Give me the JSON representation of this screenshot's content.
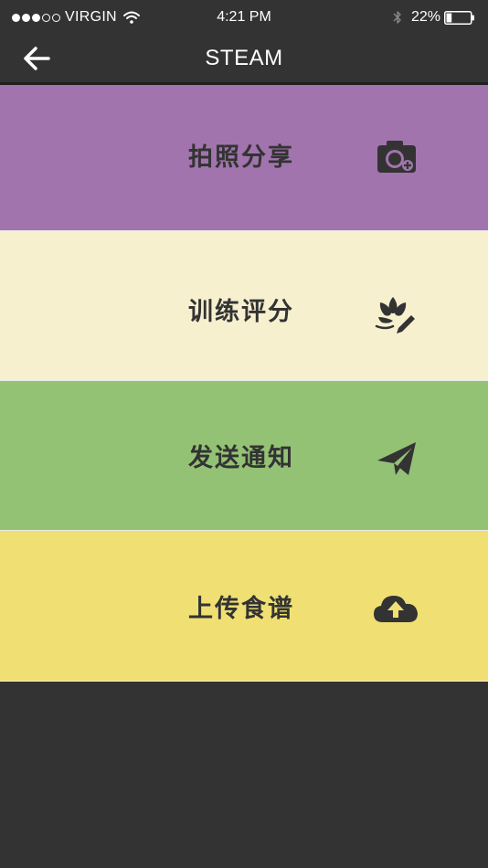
{
  "status_bar": {
    "carrier": "VIRGIN",
    "time": "4:21 PM",
    "battery": "22%",
    "signal_strength": 3,
    "signal_max": 5,
    "battery_level": 0.22
  },
  "nav": {
    "title": "STEAM",
    "back_icon": "arrow-left-icon"
  },
  "menu": {
    "items": [
      {
        "label": "拍照分享",
        "icon": "camera-add-icon",
        "color": "#a174ad"
      },
      {
        "label": "训练评分",
        "icon": "flower-pencil-icon",
        "color": "#f7f0cf"
      },
      {
        "label": "发送通知",
        "icon": "paper-plane-icon",
        "color": "#93c275"
      },
      {
        "label": "上传食谱",
        "icon": "cloud-upload-icon",
        "color": "#f0e073"
      }
    ]
  },
  "colors": {
    "bar_background": "#333333",
    "text_dark": "#333333",
    "text_light": "#ffffff"
  }
}
